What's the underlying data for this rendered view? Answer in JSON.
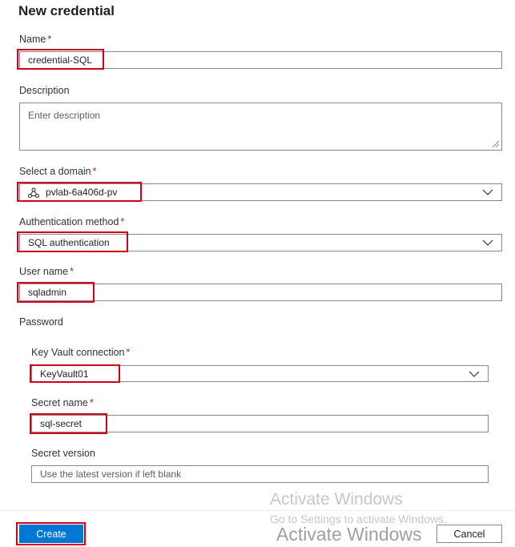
{
  "title": "New credential",
  "required_marker": "*",
  "fields": {
    "name": {
      "label": "Name",
      "value": "credential-SQL"
    },
    "description": {
      "label": "Description",
      "placeholder": "Enter description"
    },
    "domain": {
      "label": "Select a domain",
      "value": "pvlab-6a406d-pv",
      "icon": "domain-icon"
    },
    "auth_method": {
      "label": "Authentication method",
      "value": "SQL authentication"
    },
    "user_name": {
      "label": "User name",
      "value": "sqladmin"
    },
    "password": {
      "label": "Password",
      "key_vault": {
        "label": "Key Vault connection",
        "value": "KeyVault01"
      },
      "secret_name": {
        "label": "Secret name",
        "value": "sql-secret"
      },
      "secret_version": {
        "label": "Secret version",
        "placeholder": "Use the latest version if left blank"
      }
    }
  },
  "buttons": {
    "create": "Create",
    "cancel": "Cancel"
  },
  "watermark": {
    "line1": "Activate Windows",
    "line2": "Go to Settings to activate Windows.",
    "line3": "Activate Windows"
  },
  "colors": {
    "primary": "#0078d4",
    "required": "#a4262c",
    "highlight": "#d0021b"
  }
}
